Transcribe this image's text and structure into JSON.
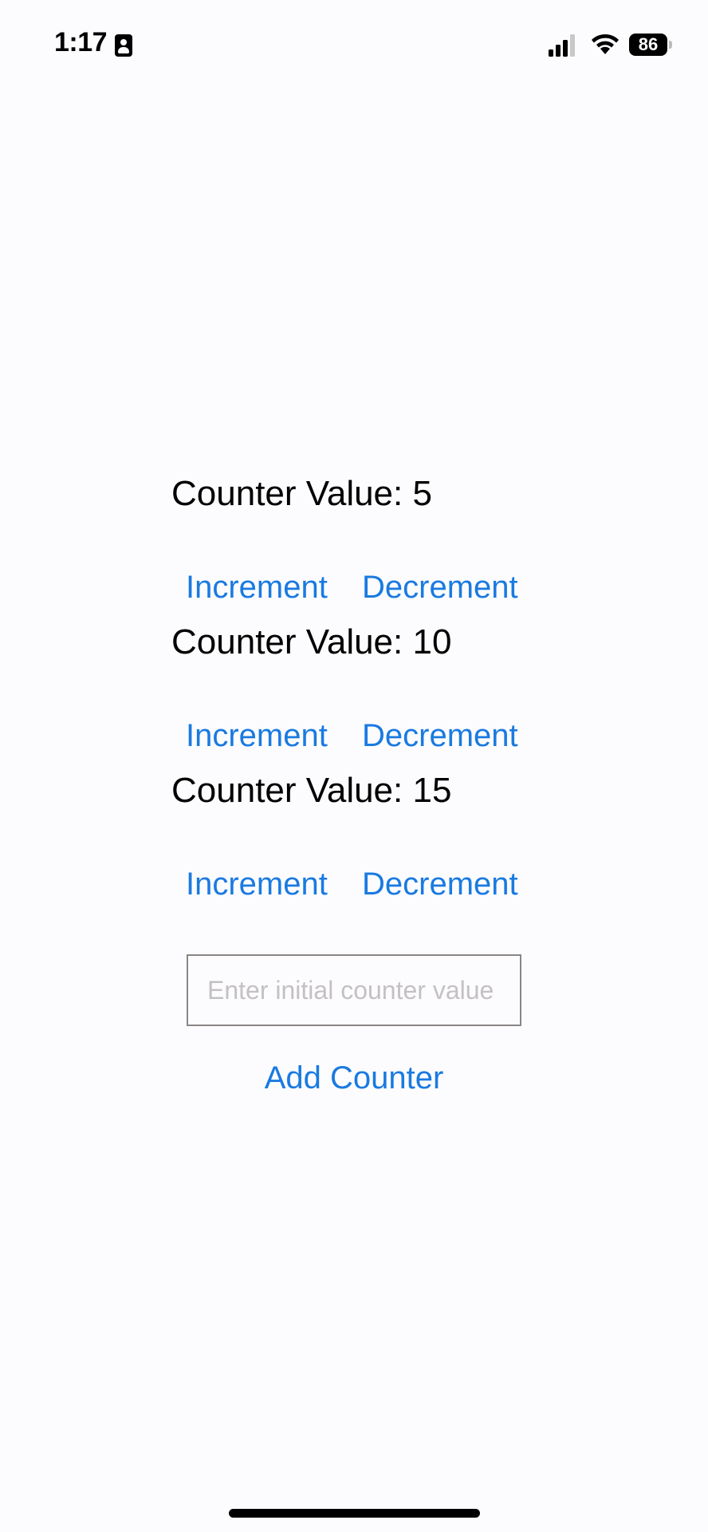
{
  "status_bar": {
    "time": "1:17",
    "battery_level": "86",
    "icons": [
      "id-card-icon",
      "signal-icon",
      "wifi-icon",
      "battery-icon"
    ]
  },
  "counters": [
    {
      "label": "Counter Value: 5",
      "increment_label": "Increment",
      "decrement_label": "Decrement"
    },
    {
      "label": "Counter Value: 10",
      "increment_label": "Increment",
      "decrement_label": "Decrement"
    },
    {
      "label": "Counter Value: 15",
      "increment_label": "Increment",
      "decrement_label": "Decrement"
    }
  ],
  "new_counter": {
    "input_value": "",
    "placeholder": "Enter initial counter value",
    "add_label": "Add Counter"
  },
  "colors": {
    "accent": "#1a7ae0",
    "background": "#fcfcfe",
    "input_border": "#8a8584",
    "placeholder": "#c4c0c4"
  }
}
